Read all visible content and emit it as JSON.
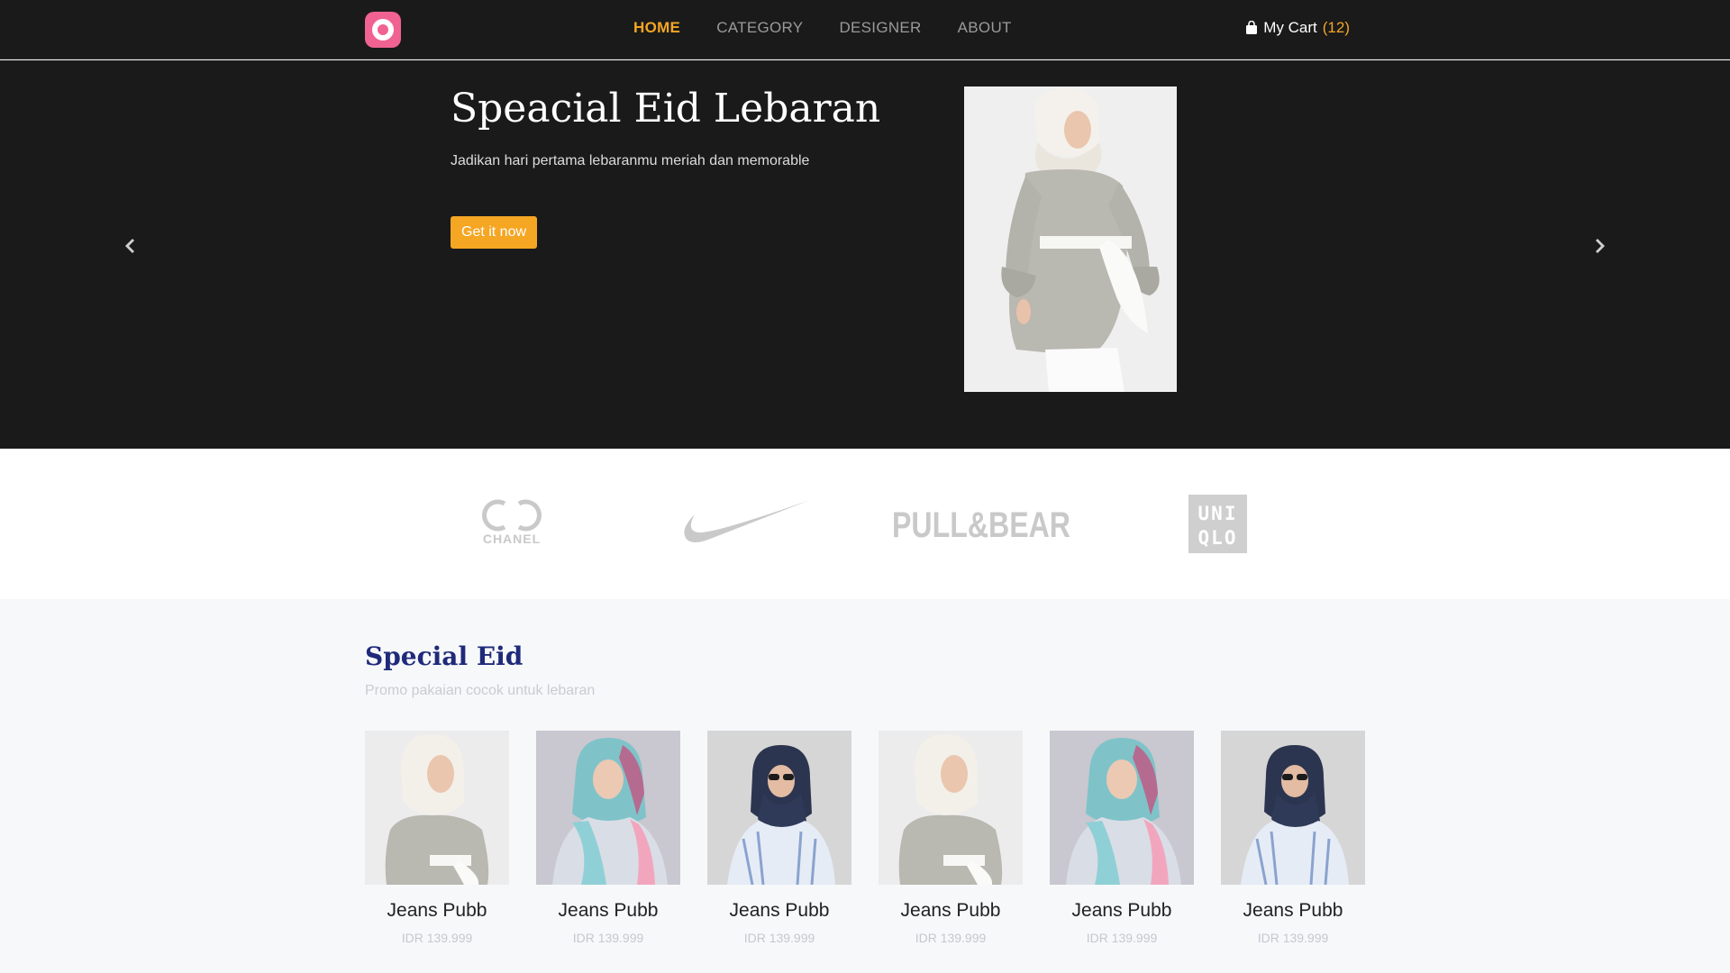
{
  "nav": {
    "links": [
      "HOME",
      "CATEGORY",
      "DESIGNER",
      "ABOUT"
    ],
    "active": "HOME",
    "cart_label": "My Cart",
    "cart_count": "(12)",
    "accent_color": "#f5a623"
  },
  "hero": {
    "title": "Speacial Eid Lebaran",
    "subtitle": "Jadikan hari pertama lebaranmu meriah dan memorable",
    "cta": "Get it now",
    "prev_icon": "chevron-left-icon",
    "next_icon": "chevron-right-icon"
  },
  "brands": [
    {
      "name": "CHANEL",
      "icon": "chanel-logo"
    },
    {
      "name": "",
      "icon": "nike-swoosh-logo"
    },
    {
      "name": "PULL&BEAR",
      "icon": "pull-and-bear-logo"
    },
    {
      "name": "UNI QLO",
      "icon": "uniqlo-logo"
    }
  ],
  "section": {
    "title": "Special Eid",
    "subtitle": "Promo pakaian cocok untuk lebaran"
  },
  "products": [
    {
      "name": "Jeans Pubb",
      "price": "IDR 139.999",
      "image": "grey-tunic"
    },
    {
      "name": "Jeans Pubb",
      "price": "IDR 139.999",
      "image": "pastel-scarf"
    },
    {
      "name": "Jeans Pubb",
      "price": "IDR 139.999",
      "image": "navy-hijab"
    },
    {
      "name": "Jeans Pubb",
      "price": "IDR 139.999",
      "image": "grey-tunic"
    },
    {
      "name": "Jeans Pubb",
      "price": "IDR 139.999",
      "image": "pastel-scarf"
    },
    {
      "name": "Jeans Pubb",
      "price": "IDR 139.999",
      "image": "navy-hijab"
    }
  ]
}
